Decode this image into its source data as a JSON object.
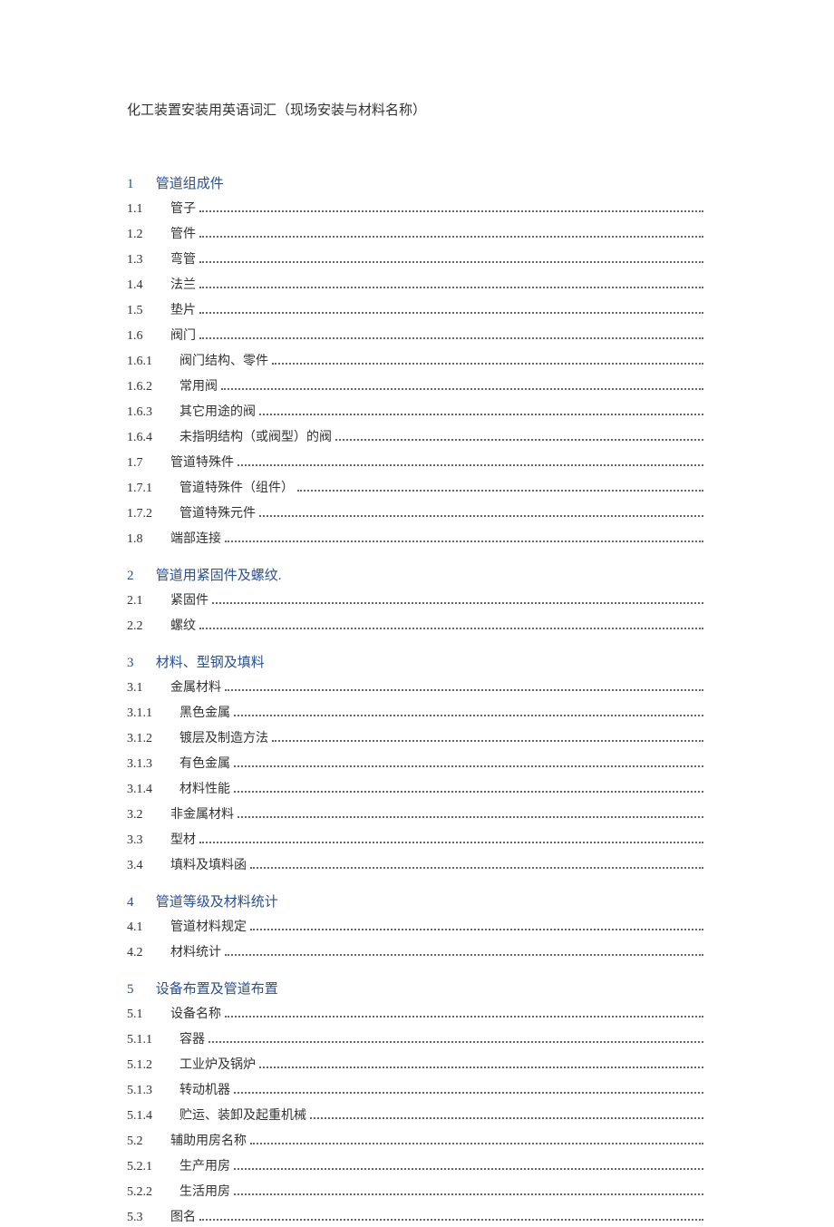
{
  "title": "化工装置安装用英语词汇（现场安装与材料名称）",
  "sections": [
    {
      "num": "1",
      "heading": "管道组成件",
      "entries": [
        {
          "num": "1.1",
          "label": "管子",
          "level": 0
        },
        {
          "num": "1.2",
          "label": "管件",
          "level": 0
        },
        {
          "num": "1.3",
          "label": "弯管",
          "level": 0
        },
        {
          "num": "1.4",
          "label": "法兰",
          "level": 0
        },
        {
          "num": "1.5",
          "label": "垫片",
          "level": 0
        },
        {
          "num": "1.6",
          "label": "阀门",
          "level": 0
        },
        {
          "num": "1.6.1",
          "label": "阀门结构、零件",
          "level": 1
        },
        {
          "num": "1.6.2",
          "label": "常用阀",
          "level": 1
        },
        {
          "num": "1.6.3",
          "label": "其它用途的阀",
          "level": 1
        },
        {
          "num": "1.6.4",
          "label": "未指明结构（或阀型）的阀",
          "level": 1
        },
        {
          "num": "1.7",
          "label": "管道特殊件",
          "level": 0
        },
        {
          "num": "1.7.1",
          "label": "管道特殊件（组件）",
          "level": 1
        },
        {
          "num": "1.7.2",
          "label": "管道特殊元件",
          "level": 1
        },
        {
          "num": "1.8",
          "label": "端部连接",
          "level": 0
        }
      ]
    },
    {
      "num": "2",
      "heading": "管道用紧固件及螺纹.",
      "entries": [
        {
          "num": "2.1",
          "label": "紧固件",
          "level": 0
        },
        {
          "num": "2.2",
          "label": "螺纹",
          "level": 0
        }
      ]
    },
    {
      "num": "3",
      "heading": "材料、型钢及填料",
      "entries": [
        {
          "num": "3.1",
          "label": "金属材料",
          "level": 0
        },
        {
          "num": "3.1.1",
          "label": "黑色金属",
          "level": 1
        },
        {
          "num": "3.1.2",
          "label": "镀层及制造方法",
          "level": 1
        },
        {
          "num": "3.1.3",
          "label": "有色金属",
          "level": 1
        },
        {
          "num": "3.1.4",
          "label": "材料性能",
          "level": 1
        },
        {
          "num": "3.2",
          "label": "非金属材料",
          "level": 0
        },
        {
          "num": "3.3",
          "label": "型材",
          "level": 0
        },
        {
          "num": "3.4",
          "label": "填料及填料函",
          "level": 0
        }
      ]
    },
    {
      "num": "4",
      "heading": "管道等级及材料统计",
      "entries": [
        {
          "num": "4.1",
          "label": "管道材料规定",
          "level": 0
        },
        {
          "num": "4.2",
          "label": "材料统计",
          "level": 0
        }
      ]
    },
    {
      "num": "5",
      "heading": "设备布置及管道布置",
      "entries": [
        {
          "num": "5.1",
          "label": "设备名称",
          "level": 0
        },
        {
          "num": "5.1.1",
          "label": "容器",
          "level": 1
        },
        {
          "num": "5.1.2",
          "label": "工业炉及锅炉",
          "level": 1
        },
        {
          "num": "5.1.3",
          "label": "转动机器",
          "level": 1
        },
        {
          "num": "5.1.4",
          "label": "贮运、装卸及起重机械",
          "level": 1
        },
        {
          "num": "5.2",
          "label": "辅助用房名称",
          "level": 0
        },
        {
          "num": "5.2.1",
          "label": "生产用房",
          "level": 1
        },
        {
          "num": "5.2.2",
          "label": "生活用房",
          "level": 1
        },
        {
          "num": "5.3",
          "label": "图名",
          "level": 0
        }
      ]
    }
  ]
}
